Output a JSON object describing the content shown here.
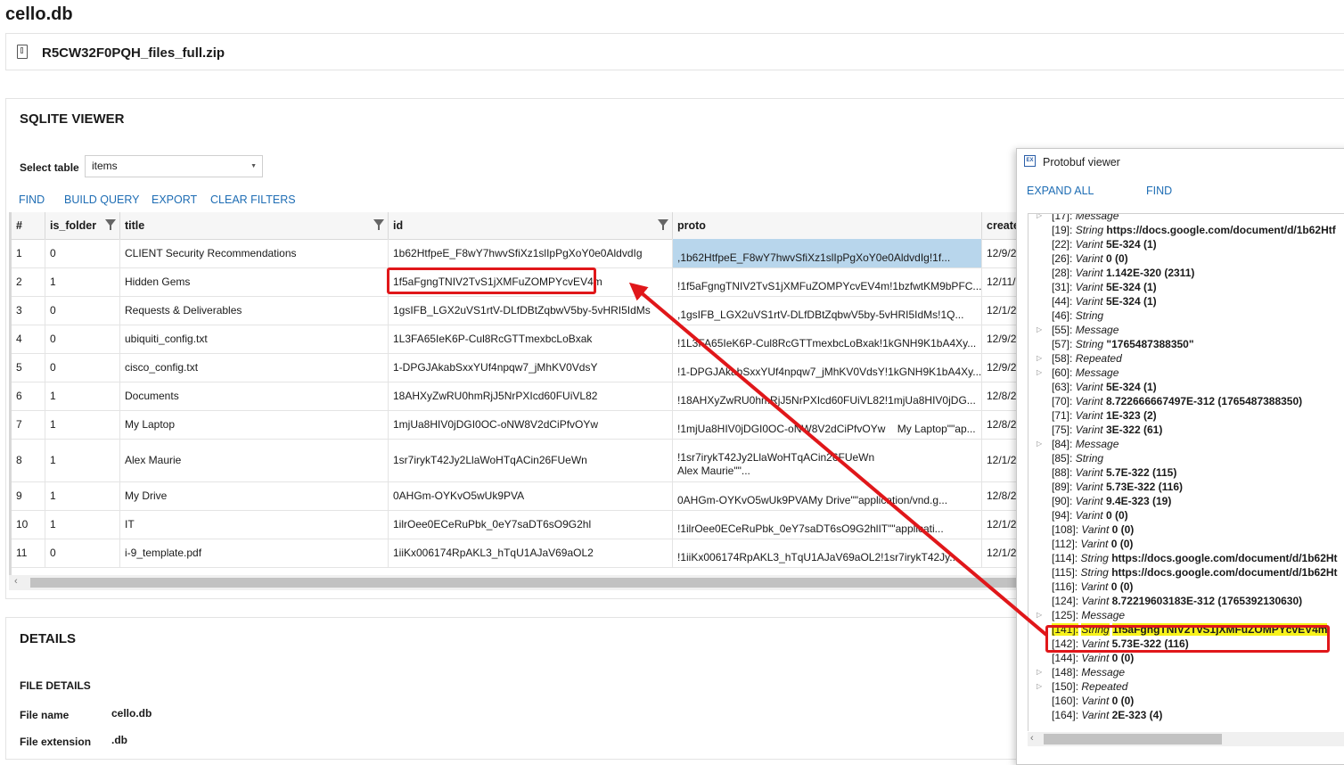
{
  "app_title": "cello.db",
  "file_panel": {
    "name": "R5CW32F0PQH_files_full.zip"
  },
  "sqlite": {
    "title": "SQLITE VIEWER",
    "select_label": "Select table",
    "selected_table": "items",
    "toolbar": [
      "FIND",
      "BUILD QUERY",
      "EXPORT",
      "CLEAR FILTERS"
    ],
    "columns": [
      "#",
      "is_folder",
      "title",
      "id",
      "proto",
      "create"
    ],
    "rows": [
      {
        "n": "1",
        "is_folder": "0",
        "title": "CLIENT Security Recommendations",
        "id": "1b62HtfpeE_F8wY7hwvSfiXz1slIpPgXoY0e0AldvdIg",
        "proto": ",1b62HtfpeE_F8wY7hwvSfiXz1slIpPgXoY0e0AldvdIg!1f...",
        "create": "12/9/2"
      },
      {
        "n": "2",
        "is_folder": "1",
        "title": "Hidden Gems",
        "id": "1f5aFgngTNIV2TvS1jXMFuZOMPYcvEV4m",
        "proto": "!1f5aFgngTNIV2TvS1jXMFuZOMPYcvEV4m!1bzfwtKM9bPFC...",
        "create": "12/11/"
      },
      {
        "n": "3",
        "is_folder": "0",
        "title": "Requests & Deliverables",
        "id": "1gsIFB_LGX2uVS1rtV-DLfDBtZqbwV5by-5vHRI5IdMs",
        "proto": ",1gsIFB_LGX2uVS1rtV-DLfDBtZqbwV5by-5vHRI5IdMs!1Q...",
        "create": "12/1/2"
      },
      {
        "n": "4",
        "is_folder": "0",
        "title": "ubiquiti_config.txt",
        "id": "1L3FA65IeK6P-Cul8RcGTTmexbcLoBxak",
        "proto": "!1L3FA65IeK6P-Cul8RcGTTmexbcLoBxak!1kGNH9K1bA4Xy...",
        "create": "12/9/2"
      },
      {
        "n": "5",
        "is_folder": "0",
        "title": "cisco_config.txt",
        "id": "1-DPGJAkabSxxYUf4npqw7_jMhKV0VdsY",
        "proto": "!1-DPGJAkabSxxYUf4npqw7_jMhKV0VdsY!1kGNH9K1bA4Xy...",
        "create": "12/9/2"
      },
      {
        "n": "6",
        "is_folder": "1",
        "title": "Documents",
        "id": "18AHXyZwRU0hmRjJ5NrPXIcd60FUiVL82",
        "proto": "!18AHXyZwRU0hmRjJ5NrPXIcd60FUiVL82!1mjUa8HIV0jDG...",
        "create": "12/8/2"
      },
      {
        "n": "7",
        "is_folder": "1",
        "title": "My Laptop",
        "id": "1mjUa8HIV0jDGI0OC-oNW8V2dCiPfvOYw",
        "proto": "!1mjUa8HIV0jDGI0OC-oNW8V2dCiPfvOYw    My Laptop\"\"ap...",
        "create": "12/8/2"
      },
      {
        "n": "8",
        "is_folder": "1",
        "title": "Alex Maurie",
        "id": "1sr7irykT42Jy2LlaWoHTqACin26FUeWn",
        "proto": "!1sr7irykT42Jy2LlaWoHTqACin26FUeWn\nAlex Maurie\"\"...",
        "create": "12/1/2"
      },
      {
        "n": "9",
        "is_folder": "1",
        "title": "My Drive",
        "id": "0AHGm-OYKvO5wUk9PVA",
        "proto": "0AHGm-OYKvO5wUk9PVAMy Drive\"\"application/vnd.g...",
        "create": "12/8/2"
      },
      {
        "n": "10",
        "is_folder": "1",
        "title": "IT",
        "id": "1ilrOee0ECeRuPbk_0eY7saDT6sO9G2hl",
        "proto": "!1ilrOee0ECeRuPbk_0eY7saDT6sO9G2hlIT\"\"applicati...",
        "create": "12/1/2"
      },
      {
        "n": "11",
        "is_folder": "0",
        "title": "i-9_template.pdf",
        "id": "1iiKx006174RpAKL3_hTqU1AJaV69aOL2",
        "proto": "!1iiKx006174RpAKL3_hTqU1AJaV69aOL2!1sr7irykT42Jy...",
        "create": "12/1/2"
      }
    ]
  },
  "details": {
    "title": "DETAILS",
    "file_details_title": "FILE DETAILS",
    "file_name_label": "File name",
    "file_name_value": "cello.db",
    "file_ext_label": "File extension",
    "file_ext_value": ".db"
  },
  "protobuf": {
    "window_title": "Protobuf viewer",
    "icon_text": "EX",
    "toolbar": [
      "EXPAND ALL",
      "FIND"
    ],
    "entries": [
      {
        "key": "[17]:",
        "type": "Message",
        "value": "",
        "expandable": true
      },
      {
        "key": "[19]:",
        "type": "String",
        "value": "https://docs.google.com/document/d/1b62Htf",
        "expandable": false
      },
      {
        "key": "[22]:",
        "type": "Varint",
        "value": "5E-324 (1)",
        "expandable": false
      },
      {
        "key": "[26]:",
        "type": "Varint",
        "value": "0 (0)",
        "expandable": false
      },
      {
        "key": "[28]:",
        "type": "Varint",
        "value": "1.142E-320 (2311)",
        "expandable": false
      },
      {
        "key": "[31]:",
        "type": "Varint",
        "value": "5E-324 (1)",
        "expandable": false
      },
      {
        "key": "[44]:",
        "type": "Varint",
        "value": "5E-324 (1)",
        "expandable": false
      },
      {
        "key": "[46]:",
        "type": "String",
        "value": "",
        "expandable": false
      },
      {
        "key": "[55]:",
        "type": "Message",
        "value": "",
        "expandable": true
      },
      {
        "key": "[57]:",
        "type": "String",
        "value": "\"1765487388350\"",
        "expandable": false
      },
      {
        "key": "[58]:",
        "type": "Repeated",
        "value": "",
        "expandable": true
      },
      {
        "key": "[60]:",
        "type": "Message",
        "value": "",
        "expandable": true
      },
      {
        "key": "[63]:",
        "type": "Varint",
        "value": "5E-324 (1)",
        "expandable": false
      },
      {
        "key": "[70]:",
        "type": "Varint",
        "value": "8.722666667497E-312 (1765487388350)",
        "expandable": false
      },
      {
        "key": "[71]:",
        "type": "Varint",
        "value": "1E-323 (2)",
        "expandable": false
      },
      {
        "key": "[75]:",
        "type": "Varint",
        "value": "3E-322 (61)",
        "expandable": false
      },
      {
        "key": "[84]:",
        "type": "Message",
        "value": "",
        "expandable": true
      },
      {
        "key": "[85]:",
        "type": "String",
        "value": "",
        "expandable": false
      },
      {
        "key": "[88]:",
        "type": "Varint",
        "value": "5.7E-322 (115)",
        "expandable": false
      },
      {
        "key": "[89]:",
        "type": "Varint",
        "value": "5.73E-322 (116)",
        "expandable": false
      },
      {
        "key": "[90]:",
        "type": "Varint",
        "value": "9.4E-323 (19)",
        "expandable": false
      },
      {
        "key": "[94]:",
        "type": "Varint",
        "value": "0 (0)",
        "expandable": false
      },
      {
        "key": "[108]:",
        "type": "Varint",
        "value": "0 (0)",
        "expandable": false
      },
      {
        "key": "[112]:",
        "type": "Varint",
        "value": "0 (0)",
        "expandable": false
      },
      {
        "key": "[114]:",
        "type": "String",
        "value": "https://docs.google.com/document/d/1b62Ht",
        "expandable": false
      },
      {
        "key": "[115]:",
        "type": "String",
        "value": "https://docs.google.com/document/d/1b62Ht",
        "expandable": false
      },
      {
        "key": "[116]:",
        "type": "Varint",
        "value": "0 (0)",
        "expandable": false
      },
      {
        "key": "[124]:",
        "type": "Varint",
        "value": "8.72219603183E-312 (1765392130630)",
        "expandable": false
      },
      {
        "key": "[125]:",
        "type": "Message",
        "value": "",
        "expandable": true
      },
      {
        "key": "[141]:",
        "type": "String",
        "value": "1f5aFgngTNIV2TvS1jXMFuZOMPYcvEV4m",
        "expandable": false,
        "highlight": true
      },
      {
        "key": "[142]:",
        "type": "Varint",
        "value": "5.73E-322 (116)",
        "expandable": false
      },
      {
        "key": "[144]:",
        "type": "Varint",
        "value": "0 (0)",
        "expandable": false
      },
      {
        "key": "[148]:",
        "type": "Message",
        "value": "",
        "expandable": true
      },
      {
        "key": "[150]:",
        "type": "Repeated",
        "value": "",
        "expandable": true
      },
      {
        "key": "[160]:",
        "type": "Varint",
        "value": "0 (0)",
        "expandable": false
      },
      {
        "key": "[164]:",
        "type": "Varint",
        "value": "2E-323 (4)",
        "expandable": false
      }
    ]
  },
  "annotation_color": "#e0171a",
  "highlight_color": "#f7f21a",
  "selection_color": "#b8d6ec"
}
